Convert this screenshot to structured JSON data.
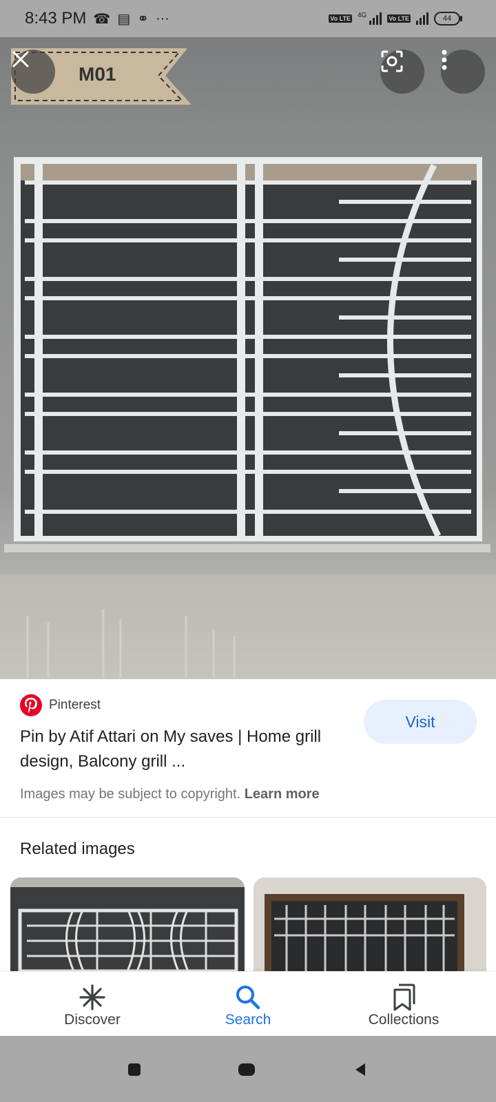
{
  "status_bar": {
    "time": "8:43 PM",
    "icons_left": [
      "missed-call-icon",
      "message-icon",
      "hotspot-icon",
      "more-dots-icon"
    ],
    "more_dots": "···",
    "network": "4G",
    "volte": "Vo LTE",
    "battery": "44"
  },
  "viewer": {
    "tag_label": "M01",
    "close_icon": "close-icon",
    "lens_icon": "lens-icon",
    "more_icon": "more-vert-icon"
  },
  "result": {
    "source": "Pinterest",
    "title": "Pin by Atif Attari on My saves | Home grill design, Balcony grill ...",
    "visit_label": "Visit",
    "copyright_text": "Images may be subject to copyright.",
    "learn_more": "Learn more"
  },
  "related": {
    "heading": "Related images"
  },
  "bottom_nav": {
    "items": [
      {
        "label": "Discover",
        "icon": "discover-icon"
      },
      {
        "label": "Search",
        "icon": "search-icon"
      },
      {
        "label": "Collections",
        "icon": "collections-icon"
      }
    ],
    "active": "Search"
  },
  "colors": {
    "accent": "#1a73e8",
    "visit_bg": "#e8f0fe",
    "pinterest": "#e60023"
  }
}
